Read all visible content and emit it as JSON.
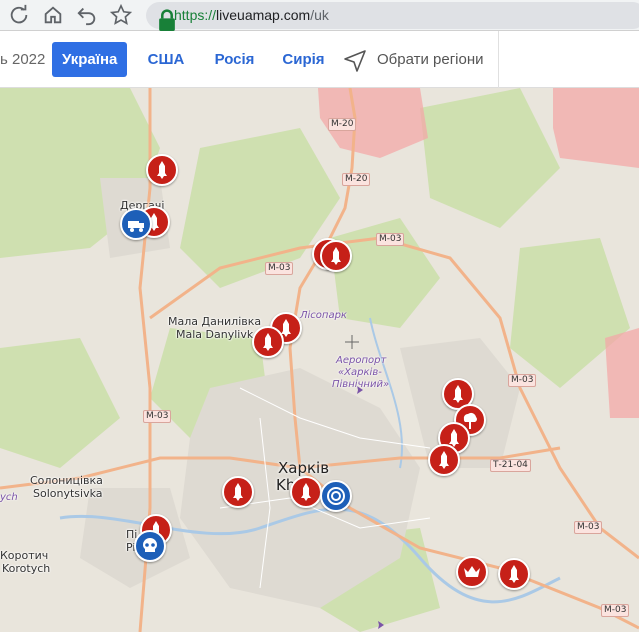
{
  "browser": {
    "url_scheme": "https://",
    "url_host": "liveuamap.com",
    "url_path": "/uk"
  },
  "nav": {
    "date_fragment": "ь 2022",
    "tabs": [
      {
        "label": "Україна",
        "active": true
      },
      {
        "label": "США",
        "active": false
      },
      {
        "label": "Росія",
        "active": false
      },
      {
        "label": "Сирія",
        "active": false
      }
    ],
    "select_regions": "Обрати регіони"
  },
  "map": {
    "places": {
      "derhachi_uk": "Дергачі",
      "mala_danylivka_uk": "Мала Данилівка",
      "mala_danylivka_en": "Mala Danylivk",
      "lisopark": "Лісопарк",
      "airport_l1": "Аеропорт",
      "airport_l2": "«Харків-",
      "airport_l3": "Північний»",
      "kharkiv_uk": "Харків",
      "kharkiv_en": "Kh",
      "solonytsivka_uk": "Солоницівка",
      "solonytsivka_en": "Solonytsivka",
      "korotych_uk": "Коротич",
      "korotych_en": "Korotych",
      "pisochyn_uk": "Пі",
      "pisochyn_en": "Pi",
      "edge_fragment": "ych"
    },
    "roads": [
      "М-20",
      "М-20",
      "М-03",
      "М-03",
      "М-03",
      "М-03",
      "Т-21-04",
      "М-03",
      "М-03"
    ],
    "markers": [
      {
        "type": "missile",
        "color": "red"
      },
      {
        "type": "missile",
        "color": "red"
      },
      {
        "type": "fire-truck",
        "color": "blue"
      },
      {
        "type": "missile",
        "color": "red"
      },
      {
        "type": "missile",
        "color": "red"
      },
      {
        "type": "missile",
        "color": "red"
      },
      {
        "type": "missile",
        "color": "red"
      },
      {
        "type": "missile",
        "color": "red"
      },
      {
        "type": "explosion",
        "color": "red"
      },
      {
        "type": "missile",
        "color": "red"
      },
      {
        "type": "missile",
        "color": "red"
      },
      {
        "type": "missile",
        "color": "red"
      },
      {
        "type": "missile",
        "color": "red"
      },
      {
        "type": "lifebuoy",
        "color": "blue"
      },
      {
        "type": "missile",
        "color": "red"
      },
      {
        "type": "skull",
        "color": "blue"
      },
      {
        "type": "crown",
        "color": "red"
      },
      {
        "type": "missile",
        "color": "red"
      }
    ]
  }
}
